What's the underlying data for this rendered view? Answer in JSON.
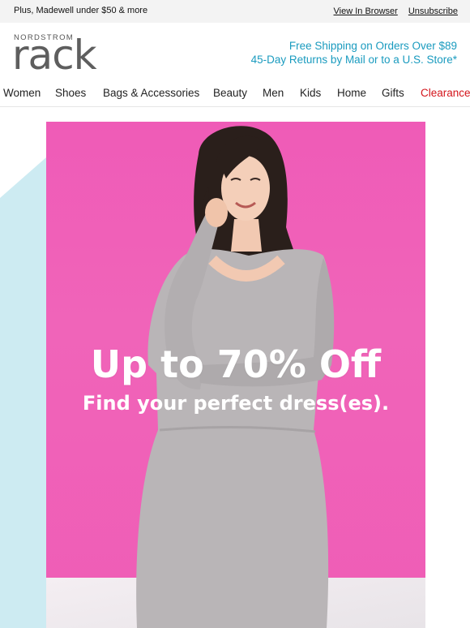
{
  "topbar": {
    "preheader": "Plus, Madewell under $50 & more",
    "view_in_browser": "View In Browser",
    "unsubscribe": "Unsubscribe"
  },
  "header": {
    "logo_top": "NORDSTROM",
    "logo_main": "rack",
    "promo_line1": "Free Shipping on Orders Over $89",
    "promo_line2": "45-Day Returns by Mail or to a U.S. Store*",
    "promo_color": "#1a9bbf"
  },
  "nav": {
    "items": [
      "Women",
      "Shoes",
      "Bags & Accessories",
      "Beauty",
      "Men",
      "Kids",
      "Home",
      "Gifts",
      "Clearance"
    ],
    "clearance_color": "#d3141b"
  },
  "hero": {
    "headline": "Up to 70% Off",
    "subline": "Find your perfect dress(es).",
    "background_color": "#ef5bb7",
    "accent_color": "#cdebf2"
  }
}
